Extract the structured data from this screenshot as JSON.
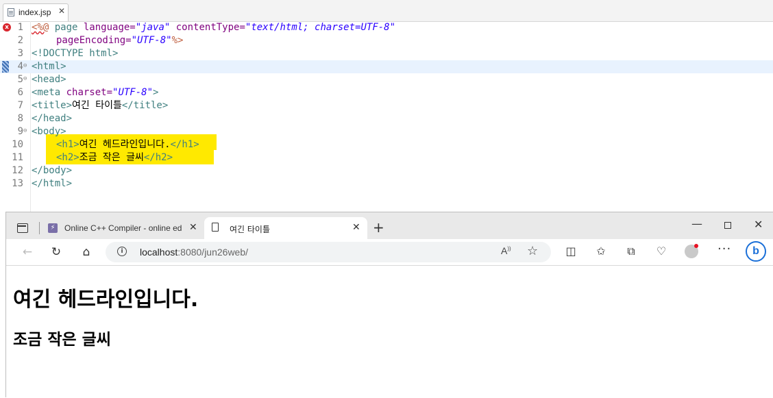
{
  "editor": {
    "tab_label": "index.jsp",
    "tab_close": "✕",
    "line_numbers": [
      "1",
      "2",
      "3",
      "4",
      "5",
      "6",
      "7",
      "8",
      "9",
      "10",
      "11",
      "12",
      "13"
    ],
    "fold_marker": "⊖",
    "error_marker": "x",
    "line1": {
      "open": "<%@",
      "page": " page ",
      "lang_attr": "language=",
      "lang_val": "\"java\"",
      "ct_attr": " contentType=",
      "ct_val": "\"text/html; charset=UTF-8\""
    },
    "line2": {
      "pe_attr": "pageEncoding=",
      "pe_val": "\"UTF-8\"",
      "close": "%>"
    },
    "line3": "<!DOCTYPE html>",
    "line4": "<html>",
    "line5": "<head>",
    "line6": {
      "tag": "<meta",
      "attr": " charset=",
      "val": "\"UTF-8\"",
      "end": ">"
    },
    "line7": {
      "open": "<title>",
      "text": "여긴 타이틀",
      "close": "</title>"
    },
    "line8": "</head>",
    "line9": "<body>",
    "line10": {
      "open": "<h1>",
      "text": "여긴 헤드라인입니다.",
      "close": "</h1>"
    },
    "line11": {
      "open": "<h2>",
      "text": "조금 작은 글씨",
      "close": "</h2>"
    },
    "line12": "</body>",
    "line13": "</html>",
    "highlight_color": "#ffe900"
  },
  "browser": {
    "vertical_tabs_icon": "vertical-tabs-icon",
    "tab1": {
      "label": "Online C++ Compiler - online ed",
      "icon": "⚡",
      "close": "✕"
    },
    "tab2": {
      "label": "여긴 타이틀",
      "close": "✕"
    },
    "new_tab": "+",
    "minimize": "—",
    "close_window": "✕",
    "back": "←",
    "reload": "↻",
    "home": "⌂",
    "info": "i",
    "url_host": "localhost",
    "url_rest": ":8080/jun26web/",
    "read_aloud": "A͏ᐧ",
    "favorite": "☆",
    "split_screen": "◫",
    "favorites_bar": "✩",
    "collections": "⧉",
    "performance": "♡",
    "more": "···",
    "bing": "b",
    "page_h1": "여긴 헤드라인입니다.",
    "page_h2": "조금 작은 글씨"
  }
}
